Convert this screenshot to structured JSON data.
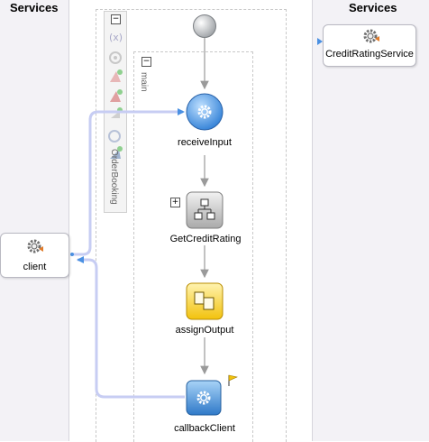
{
  "left_lane": {
    "title": "Services",
    "client_label": "client"
  },
  "right_lane": {
    "title": "Services",
    "service_label": "CreditRatingService"
  },
  "palette": {
    "label": "OrderBooking"
  },
  "main_scope": {
    "label": "main"
  },
  "activities": [
    {
      "label": "receiveInput"
    },
    {
      "label": "GetCreditRating"
    },
    {
      "label": "assignOutput"
    },
    {
      "label": "callbackClient"
    }
  ],
  "colors": {
    "accent_blue": "#4a90e2",
    "link_line": "#c7cdf3",
    "connector": "#9a9a9a"
  }
}
